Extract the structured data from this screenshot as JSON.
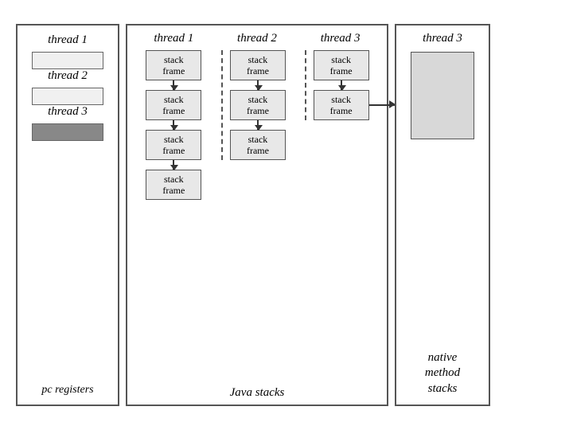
{
  "left_panel": {
    "threads": [
      {
        "label": "thread 1",
        "register_style": "light"
      },
      {
        "label": "thread 2",
        "register_style": "light"
      },
      {
        "label": "thread 3",
        "register_style": "dark"
      }
    ],
    "bottom_label": "pc registers"
  },
  "middle_panel": {
    "col_labels": [
      "thread 1",
      "thread 2",
      "thread 3"
    ],
    "columns": [
      {
        "frames": [
          "stack\nframe",
          "stack\nframe",
          "stack\nframe",
          "stack\nframe"
        ],
        "frame_count": 4
      },
      {
        "frames": [
          "stack\nframe",
          "stack\nframe",
          "stack\nframe"
        ],
        "frame_count": 3
      },
      {
        "frames": [
          "stack\nframe",
          "stack\nframe"
        ],
        "frame_count": 2
      }
    ],
    "bottom_label": "Java stacks"
  },
  "right_panel": {
    "thread_label": "thread 3",
    "bottom_label": "native\nmethod\nstacks"
  }
}
